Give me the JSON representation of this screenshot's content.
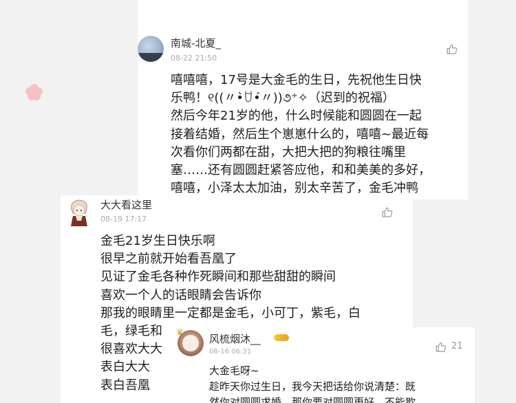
{
  "comments": [
    {
      "user": "南城-北夏_",
      "time": "08-22 21:50",
      "lines": [
        "嘻嘻嘻，17号是大金毛的生日，先祝他生日快",
        "乐鸭！୧((〃•̀ꇴ•́〃))૭⁺✧（迟到的祝福）",
        "然后今年21岁的他，什么时候能和圆圆在一起",
        "接着结婚，然后生个崽崽什么的，嘻嘻~最近每",
        "次看你们两都在甜，大把大把的狗粮往嘴里",
        "塞……还有圆圆赶紧答应他，和和美美的多好，",
        "嘻嘻，小泽太太加油，别太辛苦了，金毛冲鸭"
      ],
      "icons": {
        "like": "thumbs-up-icon",
        "avatar": "landscape-avatar"
      }
    },
    {
      "user": "大大看这里",
      "time": "08-19 17:17",
      "lines": [
        "金毛21岁生日快乐啊",
        "很早之前就开始看吾凰了",
        "见证了金毛各种作死瞬间和那些甜甜的瞬间",
        "喜欢一个人的话眼睛会告诉你",
        "那我的眼睛里一定都是金毛，小可丁，紫毛，白",
        "毛，绿毛和",
        "很喜欢大大",
        "表白大大",
        "表白吾凰"
      ],
      "icons": {
        "like": "thumbs-up-icon",
        "avatar": "anime-character-avatar"
      }
    },
    {
      "user": "风梳烟沐__",
      "time": "08-16 06:31",
      "like_count": "21",
      "lines": [
        "大金毛呀~",
        "趁昨天你过生日，我今天把话给你说清楚：既",
        "然你对圆圆求婚，那你要对圆圆更好，不能欺"
      ],
      "icons": {
        "like": "thumbs-up-icon",
        "avatar": "round-portrait-avatar",
        "badge": "crown-badge-icon"
      }
    }
  ],
  "colors": {
    "background": "#f2f2f2",
    "card": "#ffffff",
    "petal": "#f6b8bd"
  }
}
